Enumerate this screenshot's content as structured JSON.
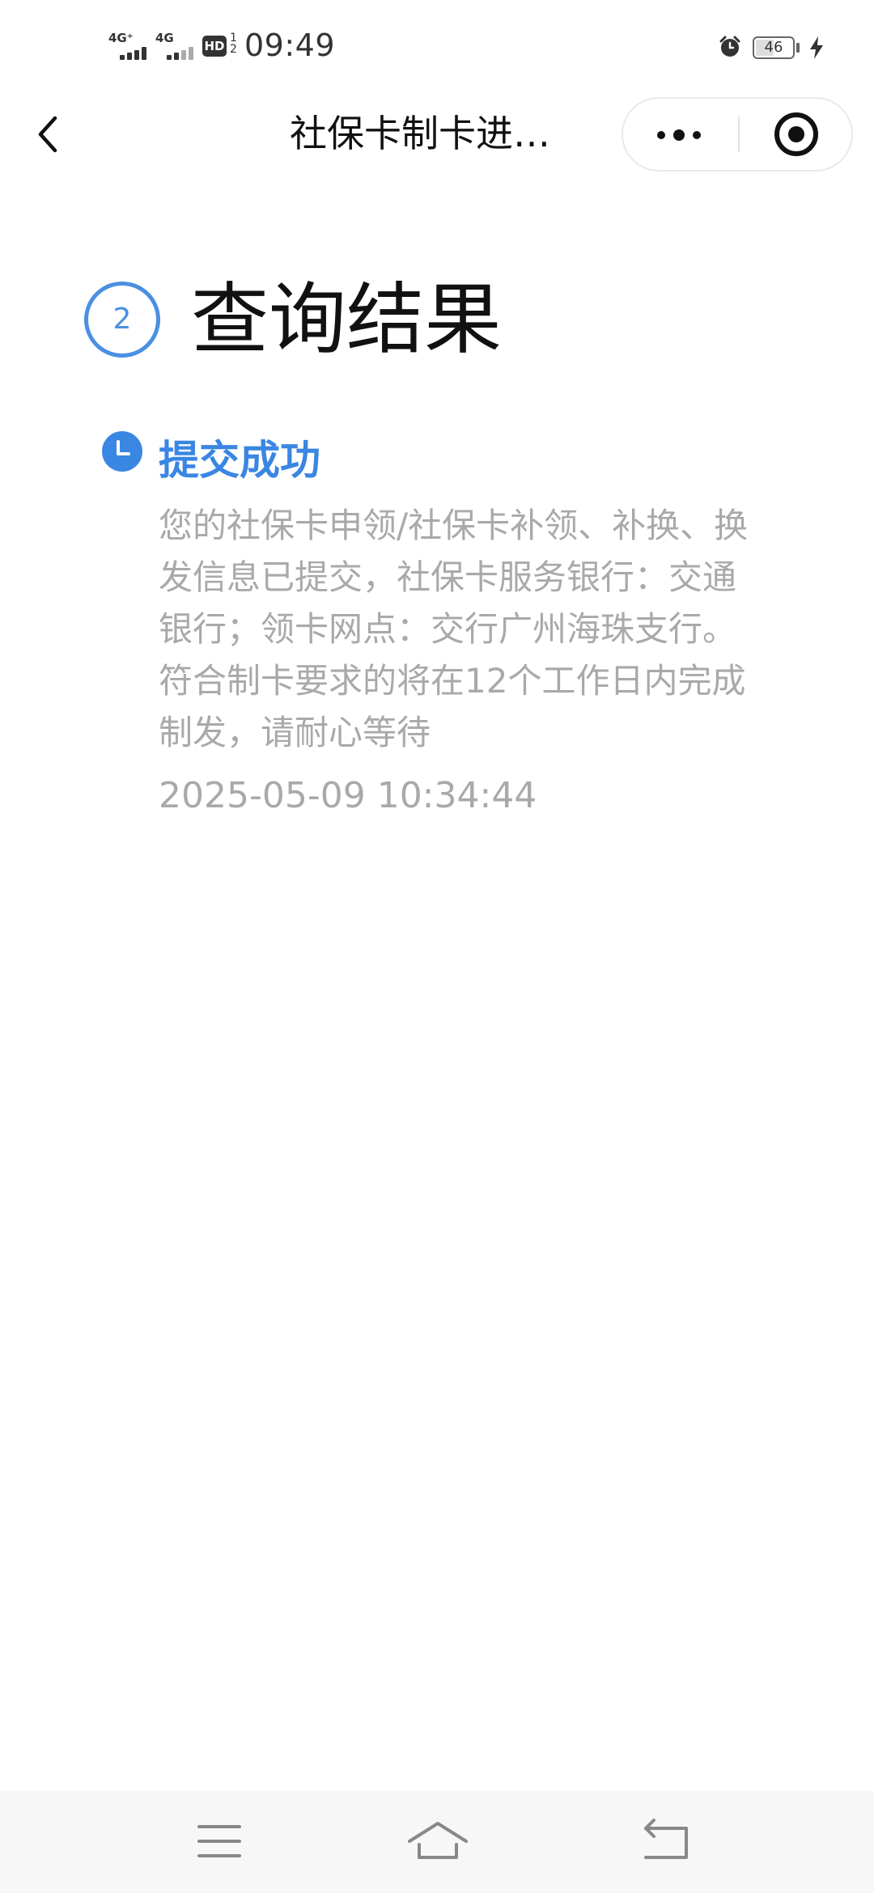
{
  "status_bar": {
    "network1": "4G⁺",
    "network2": "4G",
    "hd_label": "HD",
    "hd_sub": "1 2",
    "time": "09:49",
    "battery": "46"
  },
  "nav": {
    "title": "社保卡制卡进…"
  },
  "content": {
    "step_number": "2",
    "section_title": "查询结果",
    "status_title": "提交成功",
    "status_desc": "您的社保卡申领/社保卡补领、补换、换发信息已提交，社保卡服务银行：交通银行；领卡网点：交行广州海珠支行。符合制卡要求的将在12个工作日内完成制发，请耐心等待",
    "status_time": "2025-05-09 10:34:44"
  },
  "colors": {
    "accent": "#3a86e3",
    "muted_text": "#a9a9a9"
  },
  "icons": {
    "back": "chevron-left-icon",
    "more": "more-dots-icon",
    "close": "target-close-icon",
    "timeline": "clock-icon",
    "menu": "menu-icon",
    "home": "home-icon",
    "return": "return-icon"
  }
}
